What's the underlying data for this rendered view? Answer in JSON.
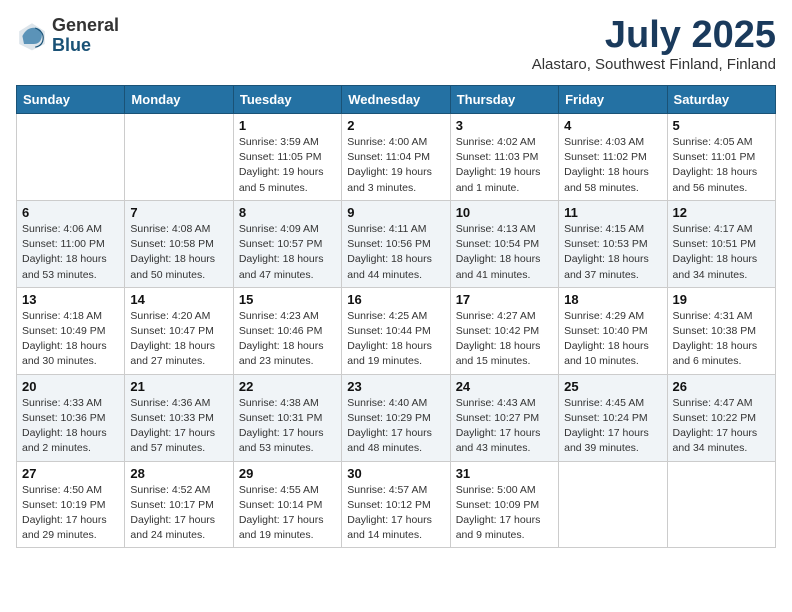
{
  "header": {
    "logo_general": "General",
    "logo_blue": "Blue",
    "month": "July 2025",
    "location": "Alastaro, Southwest Finland, Finland"
  },
  "weekdays": [
    "Sunday",
    "Monday",
    "Tuesday",
    "Wednesday",
    "Thursday",
    "Friday",
    "Saturday"
  ],
  "weeks": [
    [
      {
        "day": "",
        "detail": ""
      },
      {
        "day": "",
        "detail": ""
      },
      {
        "day": "1",
        "detail": "Sunrise: 3:59 AM\nSunset: 11:05 PM\nDaylight: 19 hours and 5 minutes."
      },
      {
        "day": "2",
        "detail": "Sunrise: 4:00 AM\nSunset: 11:04 PM\nDaylight: 19 hours and 3 minutes."
      },
      {
        "day": "3",
        "detail": "Sunrise: 4:02 AM\nSunset: 11:03 PM\nDaylight: 19 hours and 1 minute."
      },
      {
        "day": "4",
        "detail": "Sunrise: 4:03 AM\nSunset: 11:02 PM\nDaylight: 18 hours and 58 minutes."
      },
      {
        "day": "5",
        "detail": "Sunrise: 4:05 AM\nSunset: 11:01 PM\nDaylight: 18 hours and 56 minutes."
      }
    ],
    [
      {
        "day": "6",
        "detail": "Sunrise: 4:06 AM\nSunset: 11:00 PM\nDaylight: 18 hours and 53 minutes."
      },
      {
        "day": "7",
        "detail": "Sunrise: 4:08 AM\nSunset: 10:58 PM\nDaylight: 18 hours and 50 minutes."
      },
      {
        "day": "8",
        "detail": "Sunrise: 4:09 AM\nSunset: 10:57 PM\nDaylight: 18 hours and 47 minutes."
      },
      {
        "day": "9",
        "detail": "Sunrise: 4:11 AM\nSunset: 10:56 PM\nDaylight: 18 hours and 44 minutes."
      },
      {
        "day": "10",
        "detail": "Sunrise: 4:13 AM\nSunset: 10:54 PM\nDaylight: 18 hours and 41 minutes."
      },
      {
        "day": "11",
        "detail": "Sunrise: 4:15 AM\nSunset: 10:53 PM\nDaylight: 18 hours and 37 minutes."
      },
      {
        "day": "12",
        "detail": "Sunrise: 4:17 AM\nSunset: 10:51 PM\nDaylight: 18 hours and 34 minutes."
      }
    ],
    [
      {
        "day": "13",
        "detail": "Sunrise: 4:18 AM\nSunset: 10:49 PM\nDaylight: 18 hours and 30 minutes."
      },
      {
        "day": "14",
        "detail": "Sunrise: 4:20 AM\nSunset: 10:47 PM\nDaylight: 18 hours and 27 minutes."
      },
      {
        "day": "15",
        "detail": "Sunrise: 4:23 AM\nSunset: 10:46 PM\nDaylight: 18 hours and 23 minutes."
      },
      {
        "day": "16",
        "detail": "Sunrise: 4:25 AM\nSunset: 10:44 PM\nDaylight: 18 hours and 19 minutes."
      },
      {
        "day": "17",
        "detail": "Sunrise: 4:27 AM\nSunset: 10:42 PM\nDaylight: 18 hours and 15 minutes."
      },
      {
        "day": "18",
        "detail": "Sunrise: 4:29 AM\nSunset: 10:40 PM\nDaylight: 18 hours and 10 minutes."
      },
      {
        "day": "19",
        "detail": "Sunrise: 4:31 AM\nSunset: 10:38 PM\nDaylight: 18 hours and 6 minutes."
      }
    ],
    [
      {
        "day": "20",
        "detail": "Sunrise: 4:33 AM\nSunset: 10:36 PM\nDaylight: 18 hours and 2 minutes."
      },
      {
        "day": "21",
        "detail": "Sunrise: 4:36 AM\nSunset: 10:33 PM\nDaylight: 17 hours and 57 minutes."
      },
      {
        "day": "22",
        "detail": "Sunrise: 4:38 AM\nSunset: 10:31 PM\nDaylight: 17 hours and 53 minutes."
      },
      {
        "day": "23",
        "detail": "Sunrise: 4:40 AM\nSunset: 10:29 PM\nDaylight: 17 hours and 48 minutes."
      },
      {
        "day": "24",
        "detail": "Sunrise: 4:43 AM\nSunset: 10:27 PM\nDaylight: 17 hours and 43 minutes."
      },
      {
        "day": "25",
        "detail": "Sunrise: 4:45 AM\nSunset: 10:24 PM\nDaylight: 17 hours and 39 minutes."
      },
      {
        "day": "26",
        "detail": "Sunrise: 4:47 AM\nSunset: 10:22 PM\nDaylight: 17 hours and 34 minutes."
      }
    ],
    [
      {
        "day": "27",
        "detail": "Sunrise: 4:50 AM\nSunset: 10:19 PM\nDaylight: 17 hours and 29 minutes."
      },
      {
        "day": "28",
        "detail": "Sunrise: 4:52 AM\nSunset: 10:17 PM\nDaylight: 17 hours and 24 minutes."
      },
      {
        "day": "29",
        "detail": "Sunrise: 4:55 AM\nSunset: 10:14 PM\nDaylight: 17 hours and 19 minutes."
      },
      {
        "day": "30",
        "detail": "Sunrise: 4:57 AM\nSunset: 10:12 PM\nDaylight: 17 hours and 14 minutes."
      },
      {
        "day": "31",
        "detail": "Sunrise: 5:00 AM\nSunset: 10:09 PM\nDaylight: 17 hours and 9 minutes."
      },
      {
        "day": "",
        "detail": ""
      },
      {
        "day": "",
        "detail": ""
      }
    ]
  ]
}
